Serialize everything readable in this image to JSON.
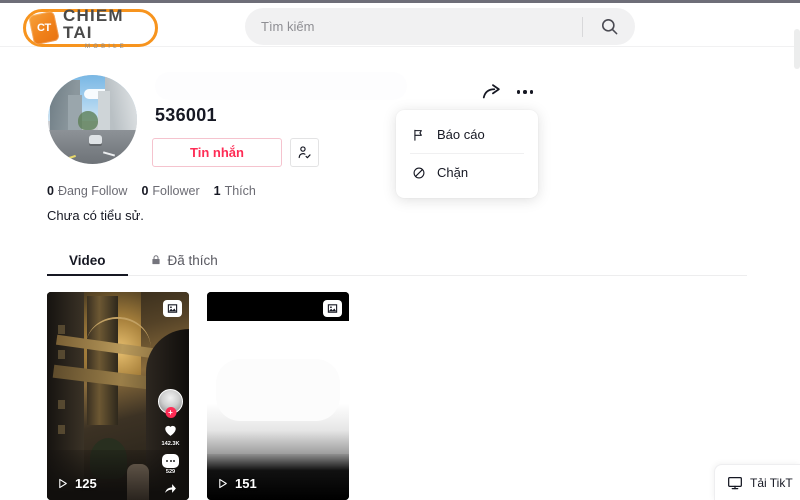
{
  "browser": {
    "chrome_bar": ""
  },
  "header": {
    "logo": {
      "badge_text": "CT",
      "title": "CHIEM TAI",
      "subtitle": "MOBILE"
    },
    "search": {
      "placeholder": "Tìm kiếm",
      "value": "",
      "icon": "search-icon"
    }
  },
  "profile": {
    "username": "536001",
    "avatar_alt": "city-street-photo",
    "message_button": "Tin nhắn",
    "follow_icon": "person-check-icon",
    "stats": [
      {
        "num": "0",
        "label": "Đang Follow"
      },
      {
        "num": "0",
        "label": "Follower"
      },
      {
        "num": "1",
        "label": "Thích"
      }
    ],
    "bio": "Chưa có tiểu sử.",
    "share_icon": "share-arrow-icon",
    "more_icon": "more-horizontal-icon"
  },
  "dropdown": {
    "items": [
      {
        "label": "Báo cáo",
        "icon": "flag-icon"
      },
      {
        "label": "Chặn",
        "icon": "block-icon"
      }
    ]
  },
  "tabs": [
    {
      "label": "Video",
      "active": true,
      "icon": ""
    },
    {
      "label": "Đã thích",
      "active": false,
      "icon": "lock-icon"
    }
  ],
  "videos": [
    {
      "play_count": "125",
      "badge_icon": "image-carousel-icon",
      "rail": {
        "avatar_plus": "+",
        "like_icon": "heart-icon",
        "like_count": "142.3K",
        "comment_icon": "comment-icon",
        "comment_count": "529",
        "share_icon": "share-icon"
      }
    },
    {
      "play_count": "151",
      "badge_icon": "image-carousel-icon"
    }
  ],
  "download_widget": {
    "label": "Tải TikT",
    "icon": "desktop-monitor-icon"
  },
  "colors": {
    "accent_red": "#fe2c55",
    "brand_orange": "#f7941e",
    "text_primary": "#161823",
    "text_muted": "#6b6b73",
    "surface_gray": "#f1f1f2"
  }
}
